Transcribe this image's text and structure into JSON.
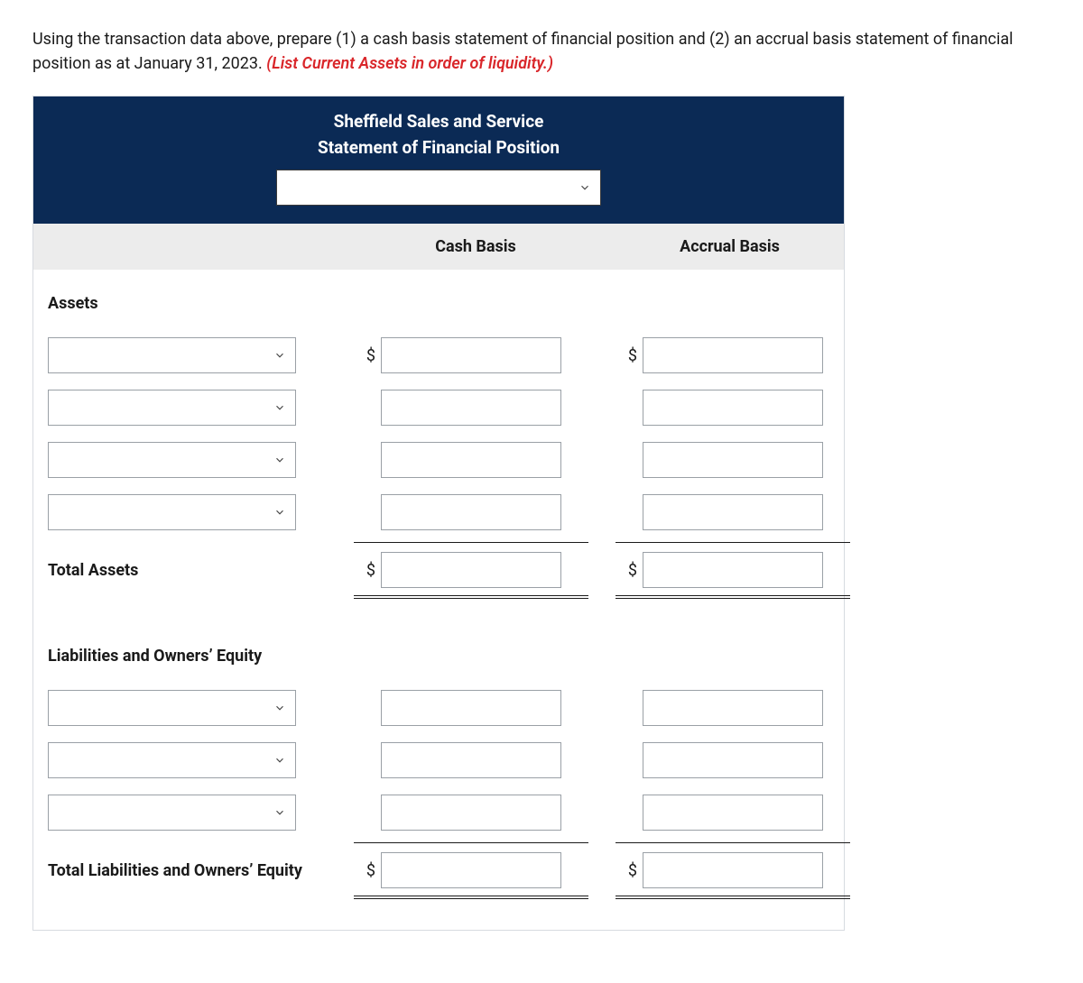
{
  "instruction": {
    "text": "Using the transaction data above, prepare (1) a cash basis statement of financial position and (2) an accrual basis statement of financial position as at January 31, 2023. ",
    "highlight": "(List Current Assets in order of liquidity.)"
  },
  "header": {
    "company": "Sheffield Sales and Service",
    "title": "Statement of Financial Position",
    "date_value": ""
  },
  "columns": {
    "cash": "Cash Basis",
    "accrual": "Accrual Basis"
  },
  "sections": {
    "assets_label": "Assets",
    "total_assets_label": "Total Assets",
    "liab_equity_label": "Liabilities and Owners’ Equity",
    "total_liab_equity_label": "Total Liabilities and Owners’ Equity"
  },
  "currency_symbol": "$",
  "rows": {
    "asset_lines": [
      {
        "label": "",
        "cash": "",
        "accrual": "",
        "show_dollar": true
      },
      {
        "label": "",
        "cash": "",
        "accrual": "",
        "show_dollar": false
      },
      {
        "label": "",
        "cash": "",
        "accrual": "",
        "show_dollar": false
      },
      {
        "label": "",
        "cash": "",
        "accrual": "",
        "show_dollar": false
      }
    ],
    "total_assets": {
      "cash": "",
      "accrual": "",
      "show_dollar": true
    },
    "liab_lines": [
      {
        "label": "",
        "cash": "",
        "accrual": "",
        "show_dollar": false
      },
      {
        "label": "",
        "cash": "",
        "accrual": "",
        "show_dollar": false
      },
      {
        "label": "",
        "cash": "",
        "accrual": "",
        "show_dollar": false
      }
    ],
    "total_liab": {
      "cash": "",
      "accrual": "",
      "show_dollar": true
    }
  }
}
